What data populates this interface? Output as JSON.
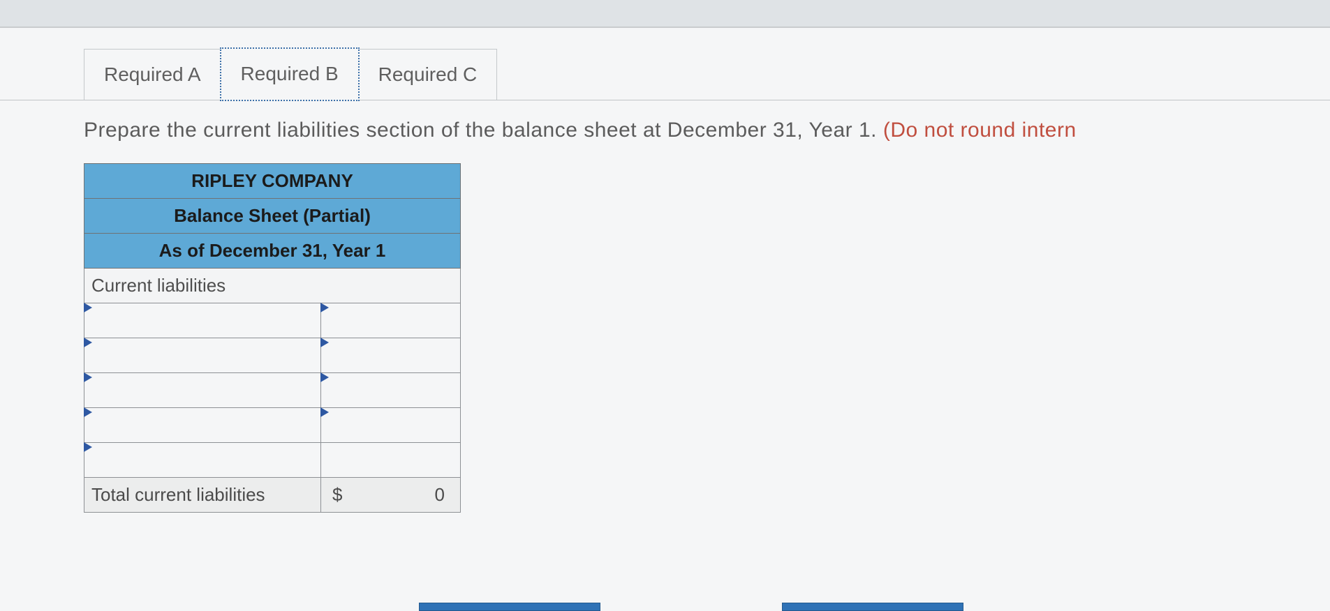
{
  "tabs": {
    "a": "Required A",
    "b": "Required B",
    "c": "Required C"
  },
  "instruction": {
    "main": "Prepare the current liabilities section of the balance sheet at December 31, Year 1. ",
    "hint": "(Do not round intern"
  },
  "sheet": {
    "company": "RIPLEY COMPANY",
    "title": "Balance Sheet (Partial)",
    "asof": "As of December 31, Year 1",
    "section": "Current liabilities",
    "rows": [
      {
        "label": "",
        "amount": ""
      },
      {
        "label": "",
        "amount": ""
      },
      {
        "label": "",
        "amount": ""
      },
      {
        "label": "",
        "amount": ""
      },
      {
        "label": "",
        "amount": ""
      }
    ],
    "total_label": "Total current liabilities",
    "total_currency": "$",
    "total_value": "0"
  }
}
